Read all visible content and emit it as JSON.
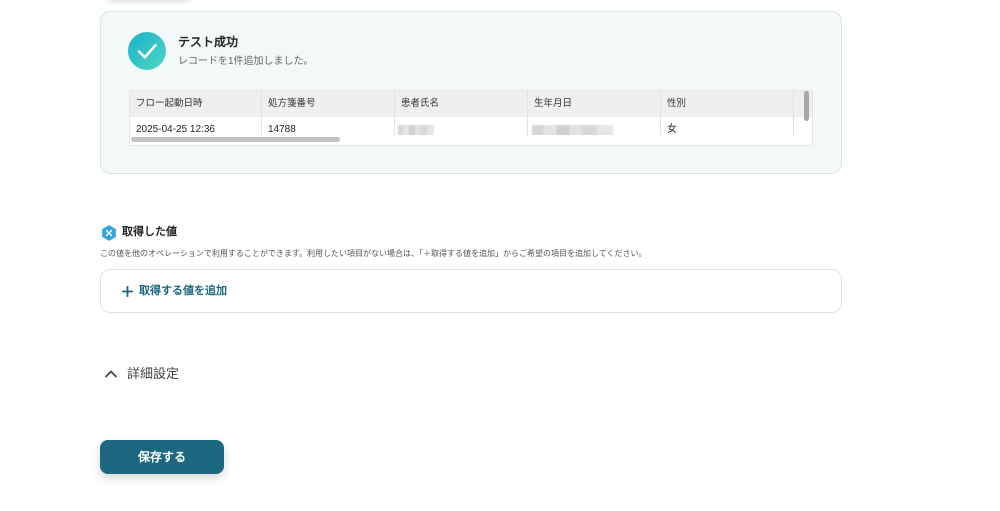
{
  "test_result": {
    "icon": "check-circle-icon",
    "title": "テスト成功",
    "message": "レコードを1件追加しました。",
    "table": {
      "columns": [
        "フロー起動日時",
        "処方箋番号",
        "患者氏名",
        "生年月日",
        "性別",
        ""
      ],
      "rows": [
        {
          "cells": [
            {
              "value": "2025-04-25 12:36",
              "redacted": false
            },
            {
              "value": "14788",
              "redacted": false
            },
            {
              "value": "",
              "redacted": true
            },
            {
              "value": "",
              "redacted": true
            },
            {
              "value": "女",
              "redacted": false
            },
            {
              "value": "",
              "redacted": false
            }
          ]
        }
      ]
    }
  },
  "retrieved_values": {
    "icon": "variable-x-icon",
    "title": "取得した値",
    "description": "この値を他のオペレーションで利用することができます。利用したい項目がない場合は、「＋取得する値を追加」からご希望の項目を追加してください。",
    "add_icon": "plus-icon",
    "add_label": "取得する値を追加"
  },
  "advanced_settings": {
    "icon": "chevron-up-icon",
    "label": "詳細設定"
  },
  "save_button": {
    "label": "保存する"
  },
  "colors": {
    "primary": "#1c6880",
    "success_start": "#19b0cc",
    "success_end": "#4fd9c3",
    "card_bg": "#f3f9f9",
    "card_border": "#d9e6e6",
    "variable_icon": "#35a8da"
  }
}
